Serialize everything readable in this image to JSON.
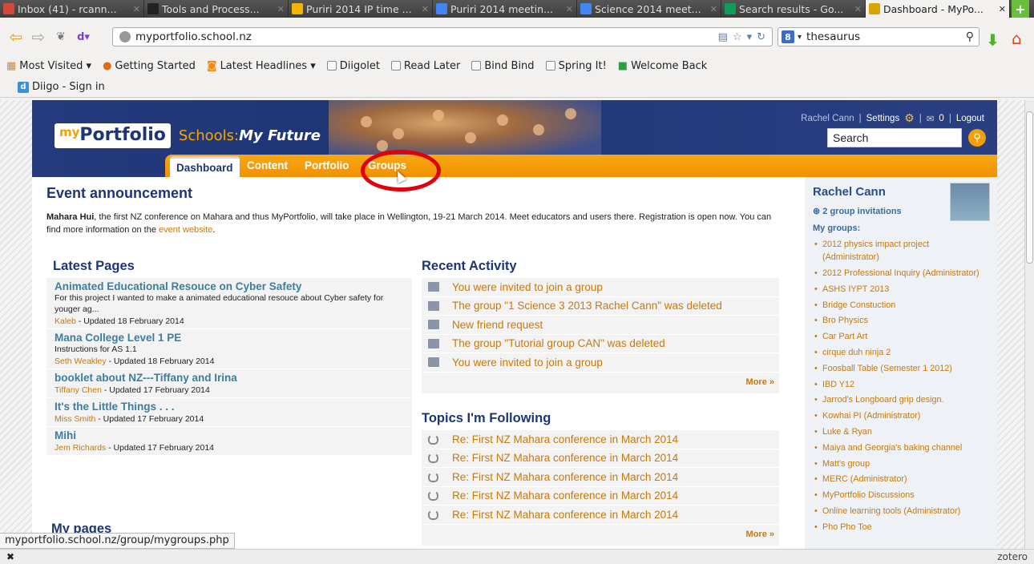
{
  "browser": {
    "tabs": [
      {
        "title": "Inbox (41) - rcann...",
        "icon_color": "#d34836",
        "active": false
      },
      {
        "title": "Tools and Process...",
        "icon_color": "#222222",
        "active": false
      },
      {
        "title": "Puriri 2014 IP time ...",
        "icon_color": "#f4b400",
        "active": false
      },
      {
        "title": "Puriri 2014 meetin...",
        "icon_color": "#4285f4",
        "active": false
      },
      {
        "title": "Science 2014 meet...",
        "icon_color": "#4285f4",
        "active": false
      },
      {
        "title": "Search results - Go...",
        "icon_color": "#0f9d58",
        "active": false
      },
      {
        "title": "Dashboard - MyPo...",
        "icon_color": "#d9a400",
        "active": true
      }
    ],
    "url": "myportfolio.school.nz",
    "search_value": "thesaurus",
    "bookmarks": [
      {
        "label": "Most Visited ▾",
        "icon": "folder-icon"
      },
      {
        "label": "Getting Started",
        "icon": "firefox-icon"
      },
      {
        "label": "Latest Headlines ▾",
        "icon": "rss-icon"
      },
      {
        "label": "Diigolet",
        "icon": "bookmarklet-icon"
      },
      {
        "label": "Read Later",
        "icon": "bookmarklet-icon"
      },
      {
        "label": "Bind Bind",
        "icon": "bookmarklet-icon"
      },
      {
        "label": "Spring It!",
        "icon": "bookmarklet-icon"
      },
      {
        "label": "Welcome Back",
        "icon": "app-icon"
      }
    ],
    "diigo": "Diigo - Sign in",
    "link_status": "myportfolio.school.nz/group/mygroups.php",
    "zotero": "zotero"
  },
  "site": {
    "logo_my": "my",
    "logo_portfolio": "Portfolio",
    "logo_schools": "Schools:",
    "logo_future": "My Future",
    "user": "Rachel Cann",
    "settings": "Settings",
    "messages": "0",
    "logout": "Logout",
    "search_value": "Search",
    "nav": [
      "Dashboard",
      "Content",
      "Portfolio",
      "Groups"
    ]
  },
  "event": {
    "heading": "Event announcement",
    "bold": "Mahara Hui",
    "text": ", the first NZ conference on Mahara and thus MyPortfolio, will take place in Wellington, 19-21 March 2014. Meet educators and users there. Registration is open now. You can find more information on the ",
    "link": "event website",
    "end": "."
  },
  "latest_pages": {
    "heading": "Latest Pages",
    "items": [
      {
        "title": "Animated Educational Resouce on Cyber Safety",
        "desc": "For this project I wanted to make a animated educational resouce about Cyber safety for youger ag...",
        "author": "Kaleb",
        "updated": " - Updated 18 February 2014"
      },
      {
        "title": "Mana College Level 1 PE",
        "desc": "Instructions for AS 1.1",
        "author": "Seth Weakley",
        "updated": " - Updated 18 February 2014"
      },
      {
        "title": "booklet about NZ---Tiffany and Irina",
        "desc": "",
        "author": "Tiffany Chen",
        "updated": " - Updated 17 February 2014"
      },
      {
        "title": "It's the Little Things . . .",
        "desc": "",
        "author": "Miss Smith",
        "updated": " - Updated 17 February 2014"
      },
      {
        "title": "Mihi",
        "desc": "",
        "author": "Jem Richards",
        "updated": " - Updated 17 February 2014"
      }
    ],
    "my_pages": "My pages"
  },
  "recent_activity": {
    "heading": "Recent Activity",
    "items": [
      "You were invited to join a group",
      "The group \"1 Science 3 2013 Rachel Cann\" was deleted",
      "New friend request",
      "The group \"Tutorial group CAN\" was deleted",
      "You were invited to join a group"
    ],
    "more": "More »"
  },
  "topics": {
    "heading": "Topics I'm Following",
    "items": [
      "Re: First NZ Mahara conference in March 2014",
      "Re: First NZ Mahara conference in March 2014",
      "Re: First NZ Mahara conference in March 2014",
      "Re: First NZ Mahara conference in March 2014",
      "Re: First NZ Mahara conference in March 2014"
    ],
    "more": "More »"
  },
  "sidebar": {
    "name": "Rachel Cann",
    "invitations": "2 group invitations",
    "my_groups_label": "My groups:",
    "groups": [
      "2012 physics impact project (Administrator)",
      "2012 Professional Inquiry (Administrator)",
      "ASHS IYPT 2013",
      "Bridge Constuction",
      "Bro Physics",
      "Car Part Art",
      "cirque duh ninja 2",
      "Foosball Table (Semester 1 2012)",
      "IBD Y12",
      "Jarrod's Longboard grip design.",
      "Kowhai PI (Administrator)",
      "Luke & Ryan",
      "Maiya and Georgia's baking channel",
      "Matt's group",
      "MERC (Administrator)",
      "MyPortfolio Discussions",
      "Online learning tools (Administrator)",
      "Pho Pho Toe"
    ]
  }
}
